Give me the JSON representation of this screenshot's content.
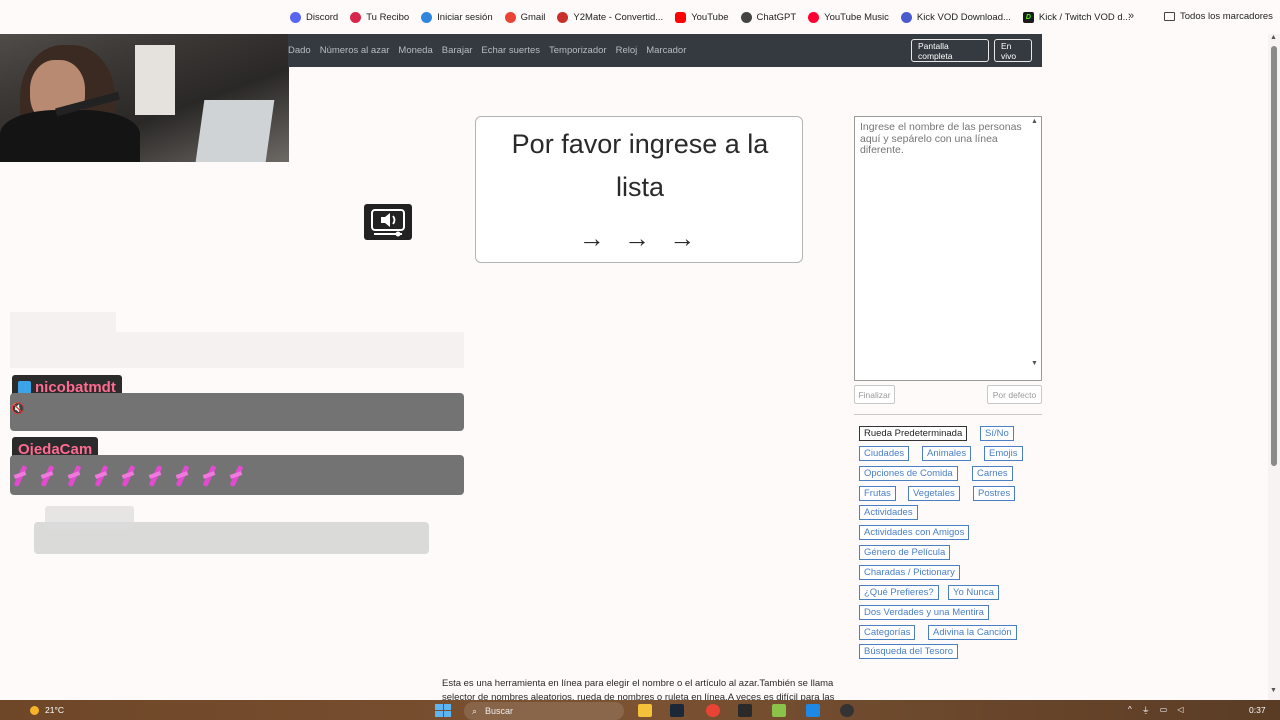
{
  "bookmarks": {
    "items": [
      {
        "label": "Discord",
        "color": "#5865F2"
      },
      {
        "label": "Tu Recibo",
        "color": "#d6264a"
      },
      {
        "label": "Iniciar sesión",
        "color": "#2e86de"
      },
      {
        "label": "Gmail",
        "color": "#ea4335"
      },
      {
        "label": "Y2Mate - Convertid...",
        "color": "#c9302c"
      },
      {
        "label": "YouTube",
        "color": "#ff0000"
      },
      {
        "label": "ChatGPT",
        "color": "#444444"
      },
      {
        "label": "YouTube Music",
        "color": "#ff0033"
      },
      {
        "label": "Kick VOD Download...",
        "color": "#4a5bd0"
      },
      {
        "label": "Kick / Twitch VOD d...",
        "color": "#1a1a1a"
      }
    ],
    "more": "»",
    "folder_label": "Todos los marcadores"
  },
  "nav": {
    "links": [
      "Dado",
      "Números al azar",
      "Moneda",
      "Barajar",
      "Echar suertes",
      "Temporizador",
      "Reloj",
      "Marcador"
    ],
    "fullscreen_label": "Pantalla completa",
    "live_label": "En vivo"
  },
  "wheel": {
    "message": "Por favor ingrese a la lista",
    "arrows": "→ → →"
  },
  "names_input": {
    "placeholder": "Ingrese el nombre de las personas aquí y sepárelo con una línea diferente.",
    "finish_label": "Finalizar",
    "default_label": "Por defecto"
  },
  "presets": {
    "items": [
      "Rueda Predeterminada",
      "Sí/No",
      "Ciudades",
      "Animales",
      "Emojis",
      "Opciones de Comida",
      "Carnes",
      "Frutas",
      "Vegetales",
      "Postres",
      "Actividades",
      "Actividades con Amigos",
      "Género de Película",
      "Charadas / Pictionary",
      "¿Qué Prefieres?",
      "Yo Nunca",
      "Dos Verdades y una Mentira",
      "Categorías",
      "Adivina la Canción",
      "Búsqueda del Tesoro"
    ]
  },
  "chat": {
    "user1": "nicobatmdt",
    "user2": "OjedaCam"
  },
  "description": "Esta es una herramienta en línea para elegir el nombre o el artículo al azar.También se llama selector de nombres aleatorios, rueda de nombres o ruleta en línea.A veces es difícil para las",
  "taskbar": {
    "temperature": "21°C",
    "search_label": "Buscar",
    "clock": "0:37"
  }
}
